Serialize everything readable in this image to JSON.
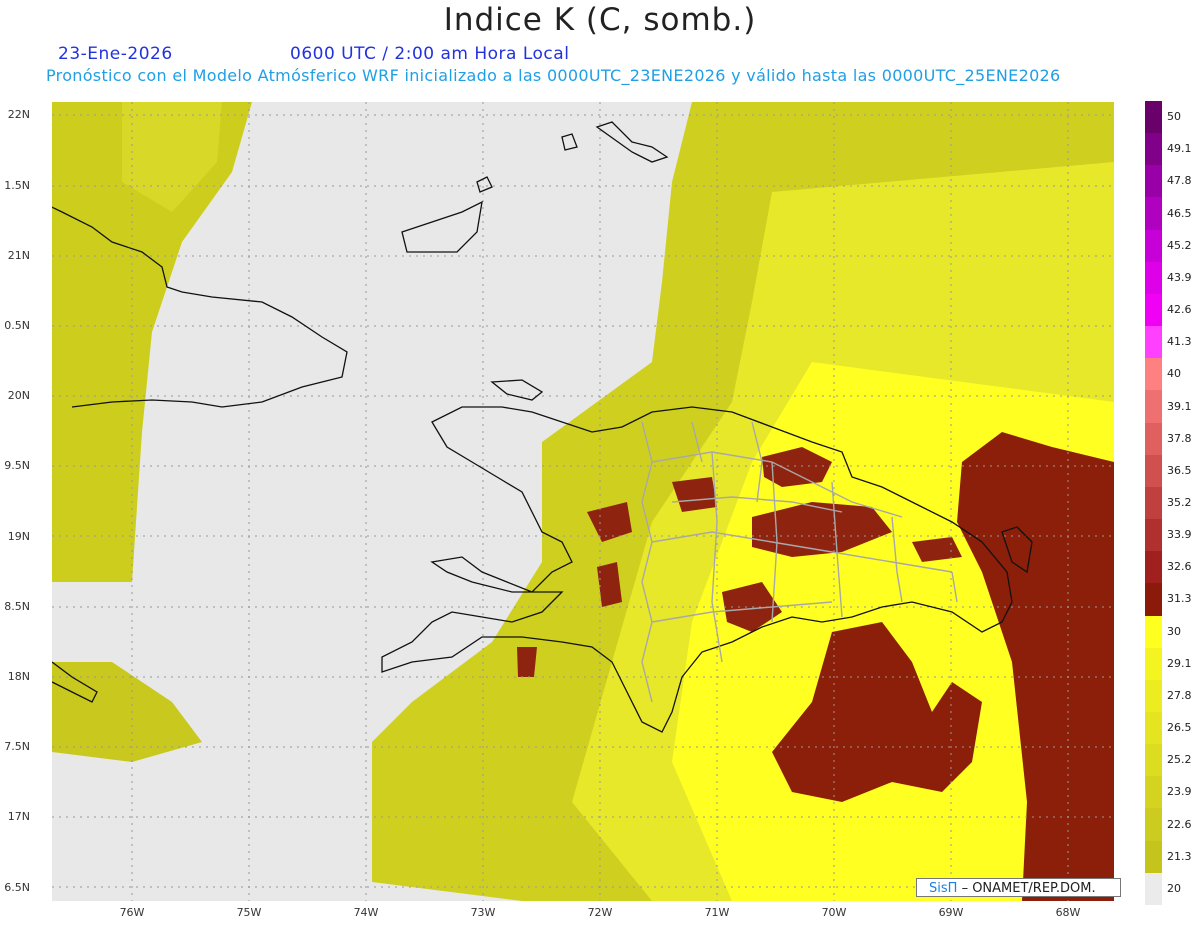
{
  "title": "Indice K (C, somb.)",
  "date": "23-Ene-2026",
  "valid_time": "0600 UTC / 2:00 am Hora Local",
  "description": "Pronóstico con el Modelo Atmósferico WRF inicializado a las 0000UTC_23ENE2026 y válido hasta las  0000UTC_25ENE2026",
  "lat_labels": [
    "22N",
    "1.5N",
    "21N",
    "0.5N",
    "20N",
    "9.5N",
    "19N",
    "8.5N",
    "18N",
    "7.5N",
    "17N",
    "6.5N"
  ],
  "lon_labels": [
    "76W",
    "75W",
    "74W",
    "73W",
    "72W",
    "71W",
    "70W",
    "69W",
    "68W"
  ],
  "colorbar": {
    "labels": [
      "50",
      "49.1",
      "47.8",
      "46.5",
      "45.2",
      "43.9",
      "42.6",
      "41.3",
      "40",
      "39.1",
      "37.8",
      "36.5",
      "35.2",
      "33.9",
      "32.6",
      "31.3",
      "30",
      "29.1",
      "27.8",
      "26.5",
      "25.2",
      "23.9",
      "22.6",
      "21.3",
      "20"
    ],
    "colors": [
      "#6a006a",
      "#80008a",
      "#9a00a8",
      "#b000c0",
      "#c800d8",
      "#de00e8",
      "#f000f4",
      "#ff40ff",
      "#ff8080",
      "#ee7070",
      "#e06060",
      "#d05050",
      "#c04040",
      "#b03030",
      "#a02020",
      "#8c1a0a",
      "#ffff20",
      "#f4f420",
      "#ecec20",
      "#e4e420",
      "#dcdc20",
      "#d4d420",
      "#cccc20",
      "#c4c41c",
      "#ebebeb"
    ]
  },
  "credit": {
    "brand": "SisΠ",
    "text": "– ONAMET/REP.DOM."
  }
}
